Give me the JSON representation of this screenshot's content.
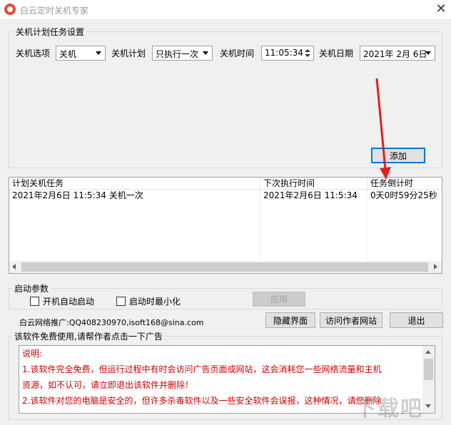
{
  "window": {
    "title": "白云定时关机专家",
    "close_glyph": "✕"
  },
  "schedule": {
    "group_title": "关机计划任务设置",
    "option_label": "关机选项",
    "option_value": "关机",
    "plan_label": "关机计划",
    "plan_value": "只执行一次",
    "time_label": "关机时间",
    "time_value": "11:05:34",
    "date_label": "关机日期",
    "date_value": "2021年 2月 6日",
    "add_button": "添加"
  },
  "tasks": {
    "columns": [
      "计划关机任务",
      "下次执行时间",
      "任务倒计时"
    ],
    "rows": [
      [
        "2021年2月6日 11:5:34 关机一次",
        "2021年2月6日 11:5:34",
        "0天0时59分25秒"
      ]
    ]
  },
  "startup": {
    "group_title": "启动参数",
    "auto_start_label": "开机自动启动",
    "auto_start_checked": false,
    "minimize_label": "启动时最小化",
    "minimize_checked": false,
    "apply_button": "应用"
  },
  "footer": {
    "promo_text": "白云网络推广:QQ408230970,isoft168@sina.com",
    "hide_button": "隐藏界面",
    "visit_button": "访问作者网站",
    "exit_button": "退出"
  },
  "notice": {
    "group_title": "该软件免费使用,请帮作者点击一下广告",
    "lines": [
      "说明:",
      "1.该软件完全免费，但运行过程中有时会访问广告页面或网站，这会消耗您一些网络流量和主机",
      "资源，如不认可，请立即退出该软件并删除！",
      "2.该软件对您的电脑是安全的，但许多杀毒软件以及一些安全软件会误报，这种情况，请您删除"
    ]
  },
  "overlay": {
    "arrow_color": "#e02020",
    "watermark_text": "下载吧"
  }
}
